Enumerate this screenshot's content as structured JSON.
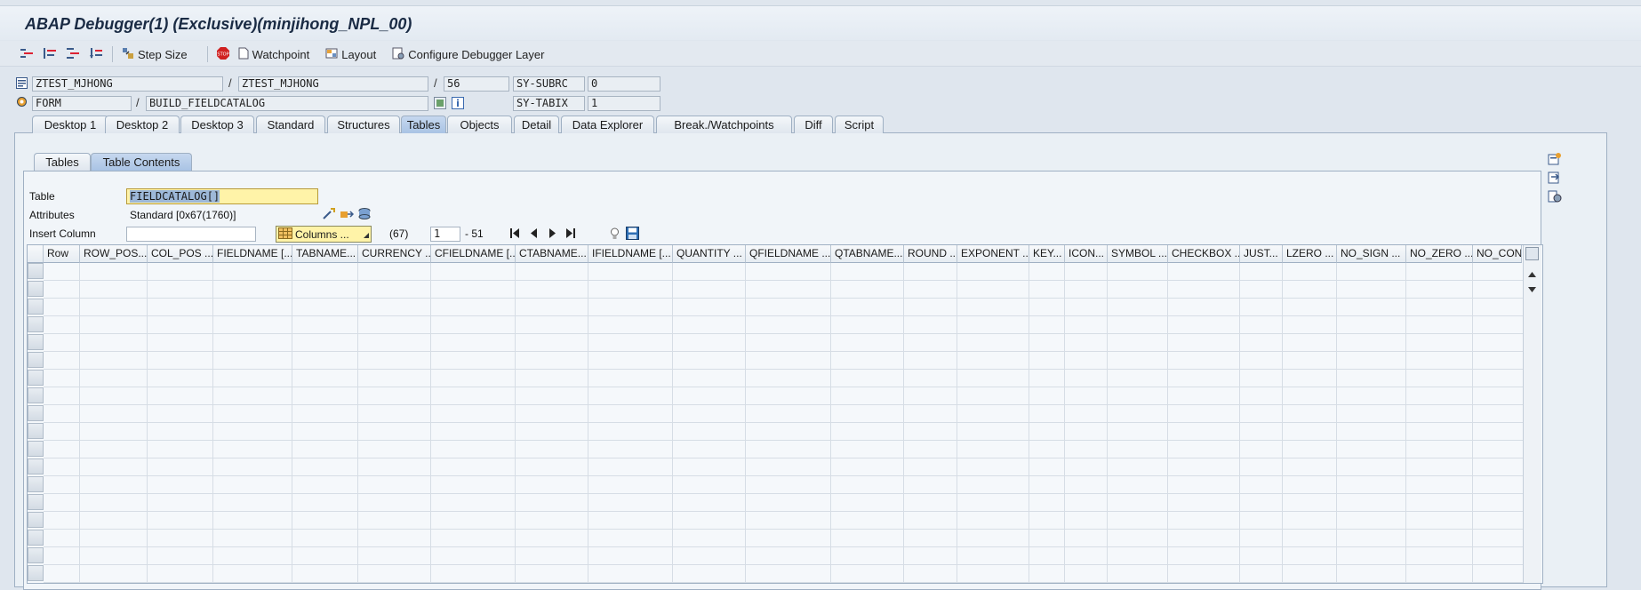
{
  "window": {
    "title": "ABAP Debugger(1)  (Exclusive)(minjihong_NPL_00)"
  },
  "toolbar": {
    "step_size": "Step Size",
    "watchpoint": "Watchpoint",
    "layout": "Layout",
    "configure": "Configure Debugger Layer"
  },
  "header_fields": {
    "program1": "ZTEST_MJHONG",
    "program2": "ZTEST_MJHONG",
    "line": "56",
    "sysvar1_name": "SY-SUBRC",
    "sysvar1_value": "0",
    "event_type": "FORM",
    "event_name": "BUILD_FIELDCATALOG",
    "sysvar2_name": "SY-TABIX",
    "sysvar2_value": "1"
  },
  "tabs": [
    {
      "label": "Desktop 1"
    },
    {
      "label": "Desktop 2"
    },
    {
      "label": "Desktop 3"
    },
    {
      "label": "Standard"
    },
    {
      "label": "Structures"
    },
    {
      "label": "Tables"
    },
    {
      "label": "Objects"
    },
    {
      "label": "Detail"
    },
    {
      "label": "Data Explorer"
    },
    {
      "label": "Break./Watchpoints"
    },
    {
      "label": "Diff"
    },
    {
      "label": "Script"
    }
  ],
  "active_tab": "Tables",
  "subtabs": [
    {
      "label": "Tables"
    },
    {
      "label": "Table Contents"
    }
  ],
  "table_section": {
    "table_label": "Table",
    "table_value": "FIELDCATALOG[]",
    "attributes_label": "Attributes",
    "attributes_value": "Standard [0x67(1760)]",
    "insert_column_label": "Insert Column",
    "insert_column_value": "",
    "columns_button": "Columns ...",
    "row_count": "(67)",
    "from_row": "1",
    "to_row": "- 51"
  },
  "grid": {
    "columns": [
      "Row",
      "ROW_POS...",
      "COL_POS ...",
      "FIELDNAME [...",
      "TABNAME...",
      "CURRENCY ...",
      "CFIELDNAME [...",
      "CTABNAME...",
      "IFIELDNAME [...",
      "QUANTITY ...",
      "QFIELDNAME ...",
      "QTABNAME...",
      "ROUND ...",
      "EXPONENT ...",
      "KEY...",
      "ICON...",
      "SYMBOL ...",
      "CHECKBOX ...",
      "JUST...",
      "LZERO ...",
      "NO_SIGN ...",
      "NO_ZERO ...",
      "NO_CONV"
    ],
    "rows": []
  },
  "colors": {
    "highlight_field": "#fff3a8",
    "active_tab": "#a9c3e4",
    "accent_red": "#d02020"
  }
}
